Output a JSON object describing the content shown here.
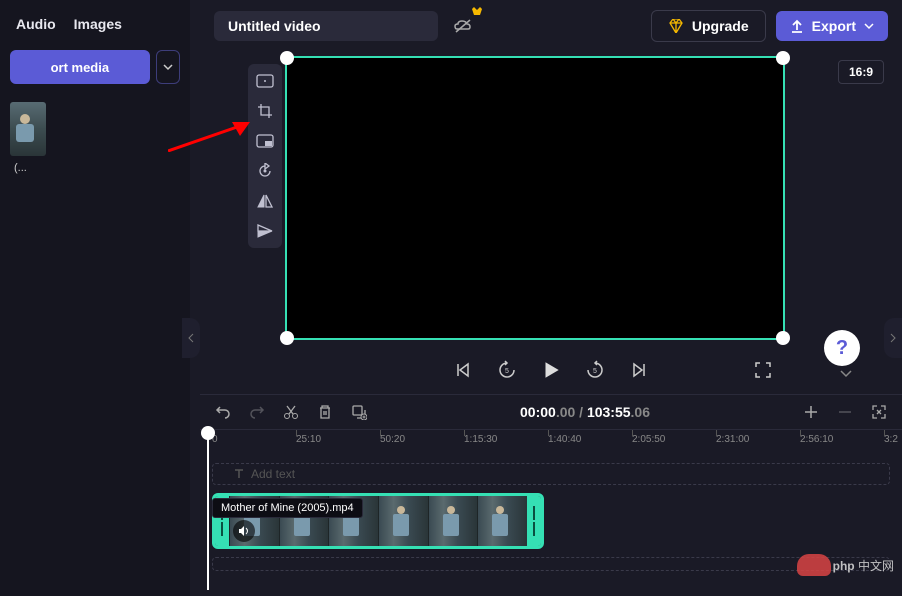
{
  "sidebar": {
    "tabs": [
      "Audio",
      "Images"
    ],
    "import_label": "ort media",
    "media_caption": "(..."
  },
  "header": {
    "title": "Untitled video",
    "upgrade_label": "Upgrade",
    "export_label": "Export",
    "aspect_ratio": "16:9"
  },
  "toolbox": {
    "tools": [
      "fit",
      "crop",
      "pip",
      "rotate",
      "flip-h",
      "flip-v"
    ]
  },
  "transport": {
    "controls": [
      "prev",
      "rewind",
      "play",
      "forward",
      "next"
    ]
  },
  "timeline": {
    "timecode_current": "00:00",
    "timecode_current_frac": ".00",
    "timecode_total": "103:55",
    "timecode_total_frac": ".06",
    "ticks": [
      "0",
      "25:10",
      "50:20",
      "1:15:30",
      "1:40:40",
      "2:05:50",
      "2:31:00",
      "2:56:10",
      "3:2"
    ],
    "add_text_label": "Add text",
    "clip_tooltip": "Mother of Mine (2005).mp4"
  },
  "watermark": {
    "brand": "php",
    "suffix": "中文网"
  }
}
